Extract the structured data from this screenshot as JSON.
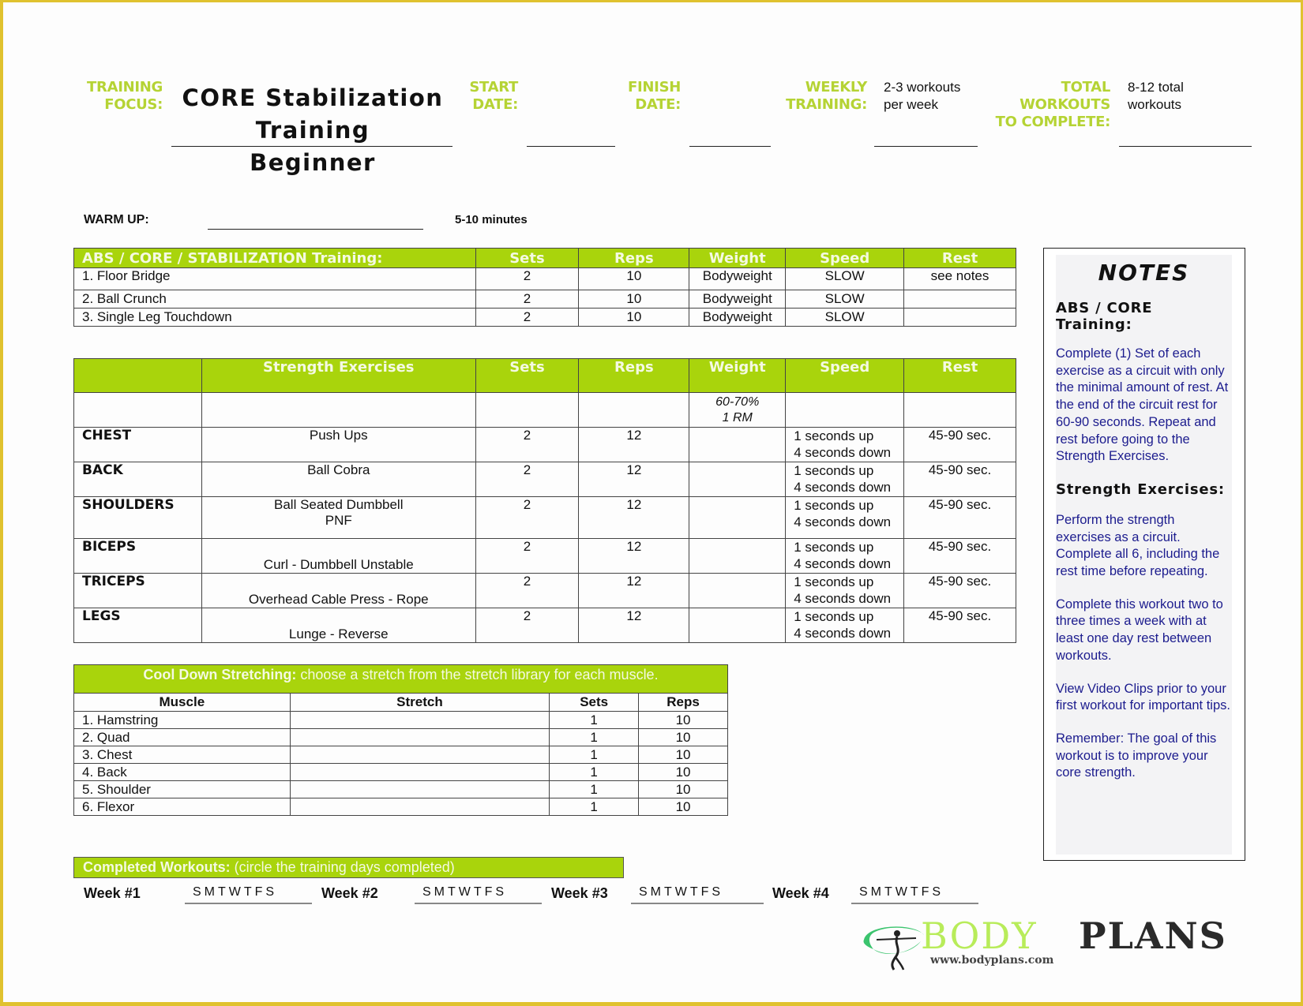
{
  "header": {
    "training_focus_label": [
      "TRAINING",
      "FOCUS:"
    ],
    "training_focus_value": [
      "CORE Stabilization",
      "Training",
      "Beginner"
    ],
    "start_date_label": [
      "START",
      "DATE:"
    ],
    "start_date_value": "",
    "finish_date_label": [
      "FINISH",
      "DATE:"
    ],
    "finish_date_value": "",
    "weekly_training_label": [
      "WEEKLY",
      "TRAINING:"
    ],
    "weekly_training_value": [
      "2-3 workouts",
      "per week"
    ],
    "total_workouts_label": [
      "TOTAL",
      "WORKOUTS",
      "TO COMPLETE:"
    ],
    "total_workouts_value": [
      "8-12 total",
      "workouts"
    ]
  },
  "warmup": {
    "label": "WARM UP:",
    "value": "",
    "duration": "5-10 minutes"
  },
  "abs_table": {
    "headers": [
      "ABS / CORE / STABILIZATION Training:",
      "Sets",
      "Reps",
      "Weight",
      "Speed",
      "Rest"
    ],
    "rows": [
      [
        "1. Floor Bridge",
        "2",
        "10",
        "Bodyweight",
        "SLOW",
        "see notes"
      ],
      [
        "2. Ball Crunch",
        "2",
        "10",
        "Bodyweight",
        "SLOW",
        ""
      ],
      [
        "3. Single Leg Touchdown",
        "2",
        "10",
        "Bodyweight",
        "SLOW",
        ""
      ]
    ]
  },
  "strength_table": {
    "headers": [
      "",
      "Strength Exercises",
      "Sets",
      "Reps",
      "Weight",
      "Speed",
      "Rest"
    ],
    "weight_note": [
      "60-70%",
      "1 RM"
    ],
    "rows": [
      {
        "muscle": "CHEST",
        "exercise": "Push Ups",
        "sets": "2",
        "reps": "12",
        "weight": "",
        "speed": [
          "1 seconds up",
          "4 seconds down"
        ],
        "rest": "45-90 sec."
      },
      {
        "muscle": "BACK",
        "exercise": "Ball Cobra",
        "sets": "2",
        "reps": "12",
        "weight": "",
        "speed": [
          "1 seconds up",
          "4 seconds down"
        ],
        "rest": "45-90 sec."
      },
      {
        "muscle": "SHOULDERS",
        "exercise": "Ball Seated Dumbbell\nPNF",
        "sets": "2",
        "reps": "12",
        "weight": "",
        "speed": [
          "1 seconds up",
          "4 seconds down"
        ],
        "rest": "45-90 sec."
      },
      {
        "muscle": "BICEPS",
        "exercise": "Curl - Dumbbell Unstable",
        "sets": "2",
        "reps": "12",
        "weight": "",
        "speed": [
          "1 seconds up",
          "4 seconds down"
        ],
        "rest": "45-90 sec."
      },
      {
        "muscle": "TRICEPS",
        "exercise": "Overhead Cable Press - Rope",
        "sets": "2",
        "reps": "12",
        "weight": "",
        "speed": [
          "1 seconds up",
          "4 seconds down"
        ],
        "rest": "45-90 sec."
      },
      {
        "muscle": "LEGS",
        "exercise": "Lunge - Reverse",
        "sets": "2",
        "reps": "12",
        "weight": "",
        "speed": [
          "1 seconds up",
          "4 seconds down"
        ],
        "rest": "45-90 sec."
      }
    ]
  },
  "cooldown_table": {
    "title_bold": "Cool Down Stretching:",
    "title_rest": " choose a stretch from the stretch library for each muscle.",
    "headers": [
      "Muscle",
      "Stretch",
      "Sets",
      "Reps"
    ],
    "rows": [
      [
        "1. Hamstring",
        "",
        "1",
        "10"
      ],
      [
        "2. Quad",
        "",
        "1",
        "10"
      ],
      [
        "3. Chest",
        "",
        "1",
        "10"
      ],
      [
        "4. Back",
        "",
        "1",
        "10"
      ],
      [
        "5. Shoulder",
        "",
        "1",
        "10"
      ],
      [
        "6. Flexor",
        "",
        "1",
        "10"
      ]
    ]
  },
  "completed_workouts": {
    "title_bold": "Completed Workouts:",
    "title_rest": " (circle the training days completed)",
    "weeks": [
      {
        "label": "Week #1",
        "days": "SMTWTFS"
      },
      {
        "label": "Week #2",
        "days": "SMTWTFS"
      },
      {
        "label": "Week #3",
        "days": "SMTWTFS"
      },
      {
        "label": "Week #4",
        "days": "SMTWTFS"
      }
    ]
  },
  "notes": {
    "title": "NOTES",
    "sections": [
      {
        "heading": "ABS / CORE Training:",
        "paragraphs": [
          "Complete (1) Set of each exercise as a circuit with only the minimal amount of rest. At the end of the circuit rest for 60-90 seconds. Repeat and rest before going to the Strength Exercises."
        ]
      },
      {
        "heading": "Strength Exercises:",
        "paragraphs": [
          "Perform the strength exercises as a circuit. Complete all 6, including the rest time before repeating.",
          "Complete this workout two to three times a week with at least one day rest between workouts.",
          "View Video Clips prior to your first workout for important tips.",
          "Remember: The goal of this workout is to improve your core strength."
        ]
      }
    ]
  },
  "logo": {
    "body": "BODY",
    "plans": "PLANS",
    "url": "www.bodyplans.com",
    "icon": "figure-in-ring-icon"
  },
  "colors": {
    "accent_green": "#a9d40c",
    "label_green": "#b5d334",
    "notes_blue": "#1c1c8e",
    "frame_gold": "#e0c22f"
  }
}
